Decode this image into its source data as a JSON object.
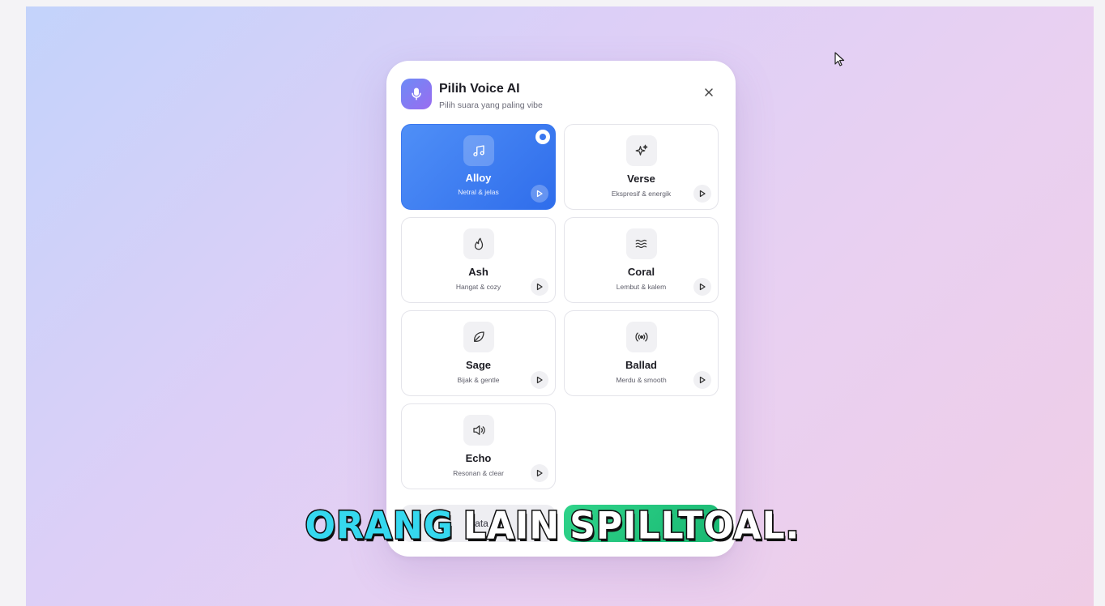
{
  "modal": {
    "title": "Pilih Voice AI",
    "subtitle": "Pilih suara yang paling vibe",
    "header_icon": "microphone-icon",
    "close_icon": "close-icon"
  },
  "voices": [
    {
      "name": "Alloy",
      "desc": "Netral & jelas",
      "icon": "music-note-icon",
      "selected": true
    },
    {
      "name": "Verse",
      "desc": "Ekspresif & energik",
      "icon": "sparkles-icon",
      "selected": false
    },
    {
      "name": "Ash",
      "desc": "Hangat & cozy",
      "icon": "flame-icon",
      "selected": false
    },
    {
      "name": "Coral",
      "desc": "Lembut & kalem",
      "icon": "waves-icon",
      "selected": false
    },
    {
      "name": "Sage",
      "desc": "Bijak & gentle",
      "icon": "leaf-icon",
      "selected": false
    },
    {
      "name": "Ballad",
      "desc": "Merdu & smooth",
      "icon": "radio-waves-icon",
      "selected": false
    },
    {
      "name": "Echo",
      "desc": "Resonan & clear",
      "icon": "speaker-icon",
      "selected": false
    }
  ],
  "footer": {
    "left_label": "Bata",
    "right_label": ""
  },
  "caption": {
    "highlight": "ORANG",
    "words": [
      "LAIN",
      "SPILLTOAL."
    ]
  },
  "colors": {
    "selected_card": "#3b78ef",
    "confirm_button": "#19b872",
    "caption_highlight": "#35d8ef"
  }
}
